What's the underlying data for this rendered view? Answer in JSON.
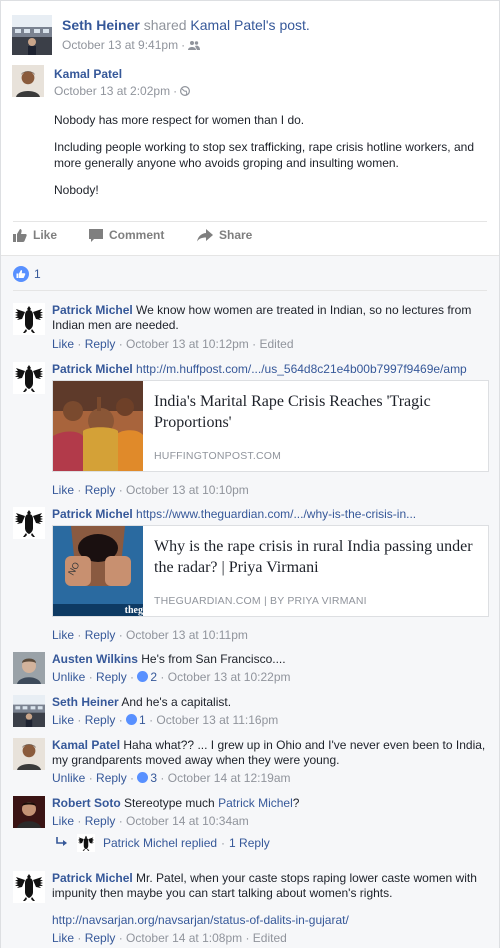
{
  "share_header": {
    "sharer_name": "Seth Heiner",
    "shared_text": "shared",
    "original_author_possessive": "Kamal Patel's",
    "post_word": "post.",
    "timestamp": "October 13 at 9:41pm",
    "audience_icon": "friends-icon"
  },
  "original_post": {
    "author": "Kamal Patel",
    "timestamp": "October 13 at 2:02pm",
    "audience_icon": "globe-icon",
    "paragraphs": [
      "Nobody has more respect for women than I do.",
      "Including people working to stop sex trafficking, rape crisis hotline workers, and more generally anyone who avoids groping and insulting women.",
      "Nobody!"
    ]
  },
  "actions": {
    "like": "Like",
    "comment": "Comment",
    "share": "Share"
  },
  "reactions": {
    "count": "1"
  },
  "comments": [
    {
      "author": "Patrick Michel",
      "text": "We know how women are treated in Indian, so no lectures from Indian men are needed.",
      "like": "Like",
      "reply": "Reply",
      "time": "October 13 at 10:12pm",
      "edited": "Edited"
    },
    {
      "author": "Patrick Michel",
      "text": "http://m.huffpost.com/.../us_564d8c21e4b00b7997f9469e/amp",
      "card_title": "India's Marital Rape Crisis Reaches 'Tragic Proportions'",
      "card_domain": "HUFFINGTONPOST.COM",
      "like": "Like",
      "reply": "Reply",
      "time": "October 13 at 10:10pm"
    },
    {
      "author": "Patrick Michel",
      "text": "https://www.theguardian.com/.../why-is-the-crisis-in...",
      "card_title": "Why is the rape crisis in rural India passing under the radar? | Priya Virmani",
      "card_domain": "THEGUARDIAN.COM | BY PRIYA VIRMANI",
      "thumb_text": "theg",
      "like": "Like",
      "reply": "Reply",
      "time": "October 13 at 10:11pm"
    },
    {
      "author": "Austen Wilkins",
      "text": "He's from San Francisco....",
      "like": "Unlike",
      "reply": "Reply",
      "likes": "2",
      "time": "October 13 at 10:22pm"
    },
    {
      "author": "Seth Heiner",
      "text": "And he's a capitalist.",
      "like": "Like",
      "reply": "Reply",
      "likes": "1",
      "time": "October 13 at 11:16pm"
    },
    {
      "author": "Kamal Patel",
      "text": "Haha what?? ... I grew up in Ohio and I've never even been to India, my grandparents moved away when they were young.",
      "like": "Unlike",
      "reply": "Reply",
      "likes": "3",
      "time": "October 14 at 12:19am"
    },
    {
      "author": "Robert Soto",
      "text": "Stereotype much",
      "mention": "Patrick Michel",
      "text_end": "?",
      "like": "Like",
      "reply": "Reply",
      "time": "October 14 at 10:34am",
      "replies_summary": "Patrick Michel replied",
      "replies_count": "1 Reply"
    },
    {
      "author": "Patrick Michel",
      "text": "Mr. Patel, when your caste stops raping lower caste women with impunity then maybe you can start talking about women's rights.",
      "link": "http://navsarjan.org/navsarjan/status-of-dalits-in-gujarat/",
      "like": "Like",
      "reply": "Reply",
      "time": "October 14 at 1:08pm",
      "edited": "Edited"
    }
  ],
  "colors": {
    "link_blue": "#365899",
    "meta_gray": "#90949c",
    "like_blue": "#5890ff",
    "comments_bg": "#f6f7f9"
  }
}
